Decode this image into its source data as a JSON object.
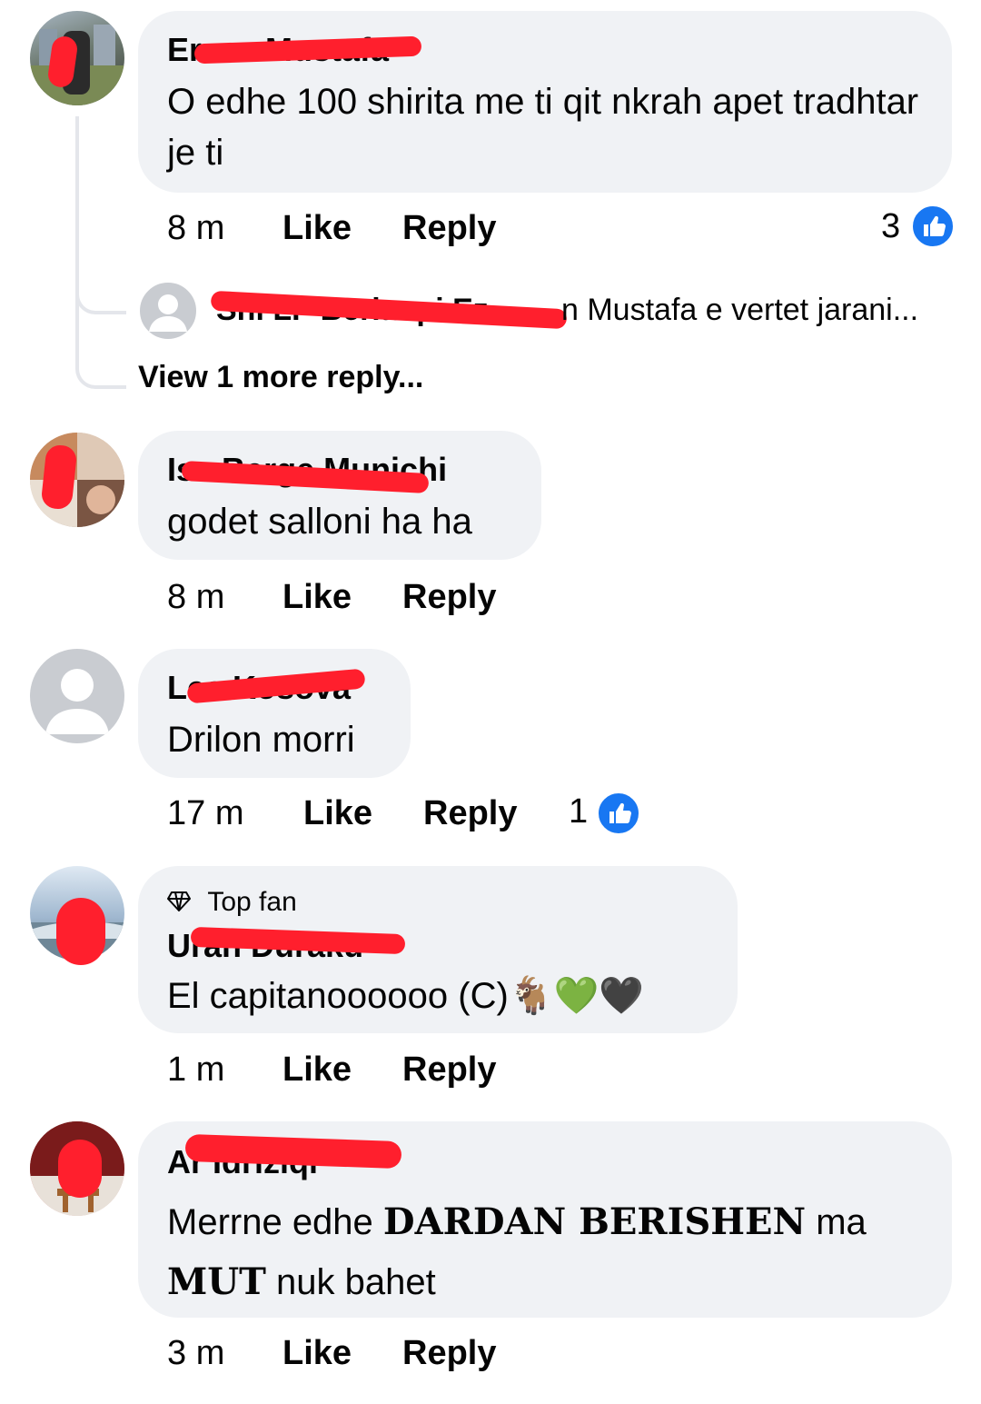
{
  "comments": [
    {
      "author": "Erzen Mustafa",
      "text": "O edhe 100 shirita me ti qit nkrah apet tradhtar je ti",
      "time": "8 m",
      "like_label": "Like",
      "reply_label": "Reply",
      "reaction_count": "3",
      "replies_preview": {
        "author": "Shi LP Berlaopi Ez",
        "text": "n Mustafa e vertet jarani...",
        "view_more": "View 1 more reply..."
      }
    },
    {
      "author": "Isa Berge Munichi",
      "text": "godet salloni ha ha",
      "time": "8 m",
      "like_label": "Like",
      "reply_label": "Reply"
    },
    {
      "author": "Lea Kosova",
      "text": "Drilon morri",
      "time": "17 m",
      "like_label": "Like",
      "reply_label": "Reply",
      "reaction_count": "1"
    },
    {
      "badge": "Top fan",
      "author": "Uran Duraku",
      "text_main": "El capitanoooooo (C)",
      "emojis": "🐐💚🖤",
      "time": "1 m",
      "like_label": "Like",
      "reply_label": "Reply"
    },
    {
      "author": "Ar Idriziqi",
      "text_part1": "Merrne edhe ",
      "text_bold1": "DARDAN BERISHEN",
      "text_part2": " ma",
      "text_bold2": "MUT",
      "text_part3": " nuk bahet",
      "time": "3 m",
      "like_label": "Like",
      "reply_label": "Reply"
    }
  ],
  "colors": {
    "bubble": "#f0f2f5",
    "like_blue": "#1877f2",
    "redaction": "#ff1f2d"
  },
  "icons": [
    "like-icon",
    "diamond-icon",
    "default-avatar-icon"
  ]
}
